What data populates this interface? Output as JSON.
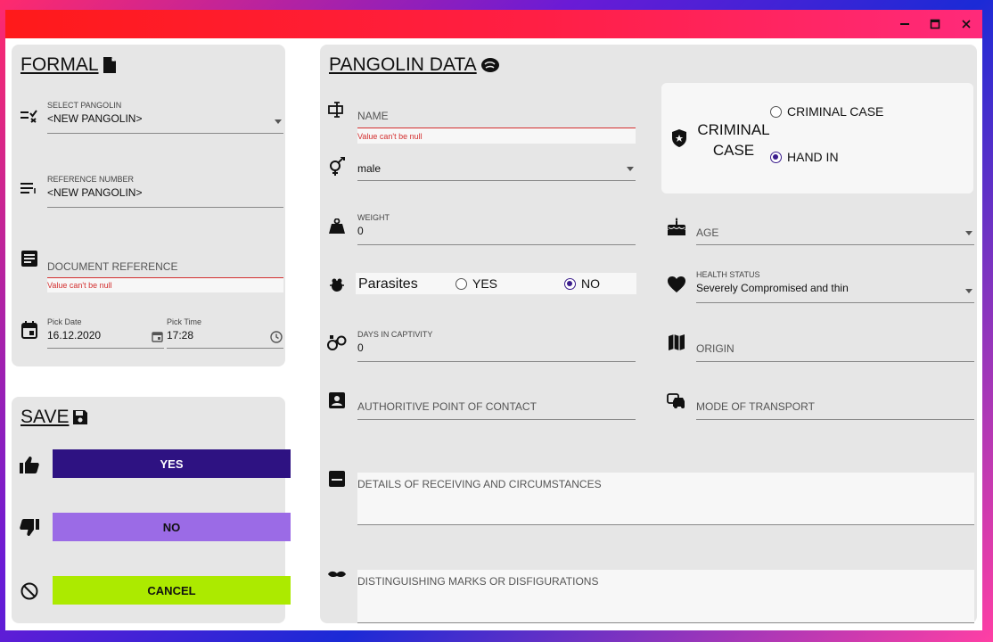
{
  "window": {
    "controls": {
      "minimize": "—",
      "maximize": "☐",
      "close": "✕"
    }
  },
  "formal": {
    "title": "FORMAL",
    "select_pangolin": {
      "label": "SELECT PANGOLIN",
      "value": "<NEW PANGOLIN>"
    },
    "reference_number": {
      "label": "REFERENCE NUMBER",
      "value": "<NEW PANGOLIN>"
    },
    "document_reference": {
      "placeholder": "DOCUMENT REFERENCE",
      "error": "Value can't be null"
    },
    "pick_date": {
      "label": "Pick Date",
      "value": "16.12.2020"
    },
    "pick_time": {
      "label": "Pick Time",
      "value": "17:28"
    }
  },
  "save": {
    "title": "SAVE",
    "yes_label": "YES",
    "no_label": "NO",
    "cancel_label": "CANCEL"
  },
  "pangolin": {
    "title": "PANGOLIN DATA",
    "name": {
      "placeholder": "NAME",
      "error": "Value can't be null"
    },
    "sex": {
      "value": "male"
    },
    "weight": {
      "label": "WEIGHT",
      "value": "0"
    },
    "parasites": {
      "label": "Parasites",
      "yes": "YES",
      "no": "NO",
      "selected": "NO"
    },
    "days_in_captivity": {
      "label": "DAYS IN CAPTIVITY",
      "value": "0"
    },
    "point_of_contact": {
      "placeholder": "AUTHORITIVE POINT OF CONTACT"
    },
    "criminal_case": {
      "label_line1": "CRIMINAL",
      "label_line2": "CASE",
      "option_criminal": "CRIMINAL CASE",
      "option_hand_in": "HAND IN",
      "selected": "HAND IN"
    },
    "age": {
      "placeholder": "AGE"
    },
    "health_status": {
      "label": "HEALTH STATUS",
      "value": "Severely Compromised and thin"
    },
    "origin": {
      "placeholder": "ORIGIN"
    },
    "mode_of_transport": {
      "placeholder": "MODE OF TRANSPORT"
    },
    "details": {
      "placeholder": "DETAILS OF RECEIVING AND CIRCUMSTANCES"
    },
    "marks": {
      "placeholder": "DISTINGUISHING MARKS OR DISFIGURATIONS"
    }
  },
  "colors": {
    "yes_button": "#2e1282",
    "no_button": "#9b6be6",
    "cancel_button": "#acea00",
    "radio_accent": "#3b1d8c",
    "error": "#d32f2f"
  }
}
